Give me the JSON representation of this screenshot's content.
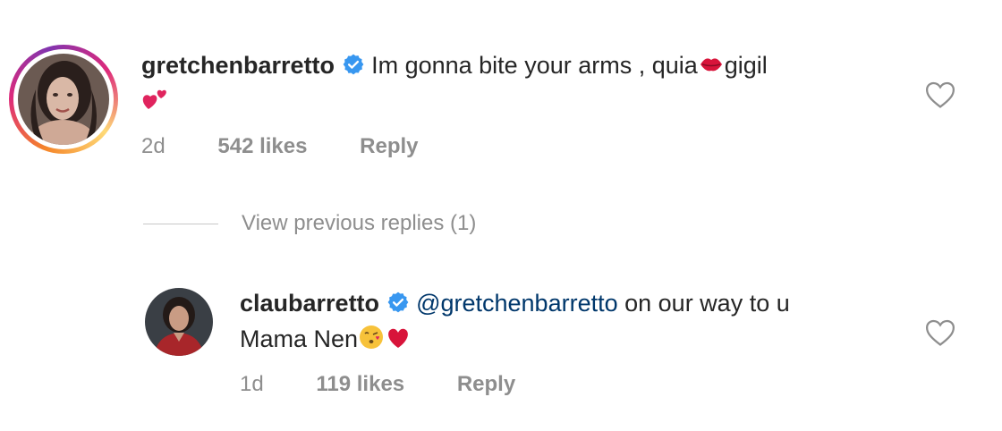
{
  "comments": [
    {
      "username": "gretchenbarretto",
      "text_part1": "Im gonna bite your arms , quia",
      "text_part2": "gigil",
      "time": "2d",
      "likes": "542 likes",
      "reply_label": "Reply",
      "avatar_ring": true
    },
    {
      "username": "claubarretto",
      "mention": "@gretchenbarretto",
      "text_part1": " on our way to u",
      "text_part2": "Mama Nen",
      "time": "1d",
      "likes": "119 likes",
      "reply_label": "Reply",
      "avatar_ring": false
    }
  ],
  "view_replies_label": "View previous replies (1)",
  "colors": {
    "text": "#262626",
    "meta": "#8e8e8e",
    "mention": "#00376b",
    "verified": "#3897f0",
    "emoji_red": "#e0245e"
  },
  "icons": [
    "verified-badge-icon",
    "heart-outline-icon",
    "kiss-lips-emoji",
    "two-hearts-emoji",
    "kissing-face-emoji",
    "red-heart-emoji"
  ]
}
